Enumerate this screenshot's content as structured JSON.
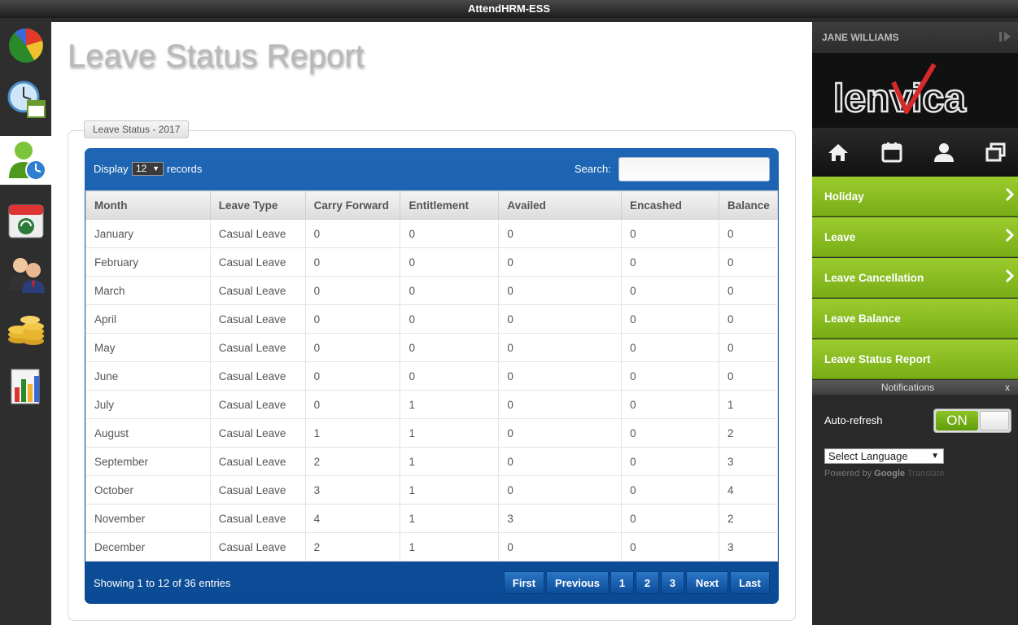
{
  "window": {
    "title": "AttendHRM-ESS"
  },
  "page": {
    "title": "Leave Status Report",
    "legend": "Leave Status - 2017"
  },
  "table_controls": {
    "display_label": "Display",
    "display_value": "12",
    "records_label": "records",
    "search_label": "Search:",
    "search_value": ""
  },
  "table": {
    "columns": [
      "Month",
      "Leave Type",
      "Carry Forward",
      "Entitlement",
      "Availed",
      "Encashed",
      "Balance"
    ],
    "rows": [
      [
        "January",
        "Casual Leave",
        "0",
        "0",
        "0",
        "0",
        "0"
      ],
      [
        "February",
        "Casual Leave",
        "0",
        "0",
        "0",
        "0",
        "0"
      ],
      [
        "March",
        "Casual Leave",
        "0",
        "0",
        "0",
        "0",
        "0"
      ],
      [
        "April",
        "Casual Leave",
        "0",
        "0",
        "0",
        "0",
        "0"
      ],
      [
        "May",
        "Casual Leave",
        "0",
        "0",
        "0",
        "0",
        "0"
      ],
      [
        "June",
        "Casual Leave",
        "0",
        "0",
        "0",
        "0",
        "0"
      ],
      [
        "July",
        "Casual Leave",
        "0",
        "1",
        "0",
        "0",
        "1"
      ],
      [
        "August",
        "Casual Leave",
        "1",
        "1",
        "0",
        "0",
        "2"
      ],
      [
        "September",
        "Casual Leave",
        "2",
        "1",
        "0",
        "0",
        "3"
      ],
      [
        "October",
        "Casual Leave",
        "3",
        "1",
        "0",
        "0",
        "4"
      ],
      [
        "November",
        "Casual Leave",
        "4",
        "1",
        "3",
        "0",
        "2"
      ],
      [
        "December",
        "Casual Leave",
        "2",
        "1",
        "0",
        "0",
        "3"
      ]
    ]
  },
  "pagination": {
    "showing": "Showing 1 to 12 of 36 entries",
    "first": "First",
    "previous": "Previous",
    "pages": [
      "1",
      "2",
      "3"
    ],
    "next": "Next",
    "last": "Last"
  },
  "sidebar": {
    "user": "JANE WILLIAMS",
    "logo_text": "lenvica",
    "menu": [
      "Holiday",
      "Leave",
      "Leave Cancellation",
      "Leave Balance",
      "Leave Status Report"
    ],
    "notifications_title": "Notifications",
    "notifications_close": "x",
    "auto_refresh_label": "Auto-refresh",
    "toggle_state": "ON",
    "language_select": "Select Language",
    "powered_by": "Powered by",
    "google": "Google",
    "translate": "Translate"
  },
  "icons": {
    "left_nav": [
      "dashboard-pie-icon",
      "attendance-clock-icon",
      "employee-leave-icon",
      "calendar-icon",
      "users-icon",
      "payroll-coins-icon",
      "reports-chart-icon"
    ],
    "top_row": [
      "home-icon",
      "calendar-icon",
      "user-icon",
      "window-icon"
    ]
  },
  "colors": {
    "panel_blue": "#0b4a94",
    "menu_green": "#8cc524",
    "logo_red": "#d42a2a"
  }
}
